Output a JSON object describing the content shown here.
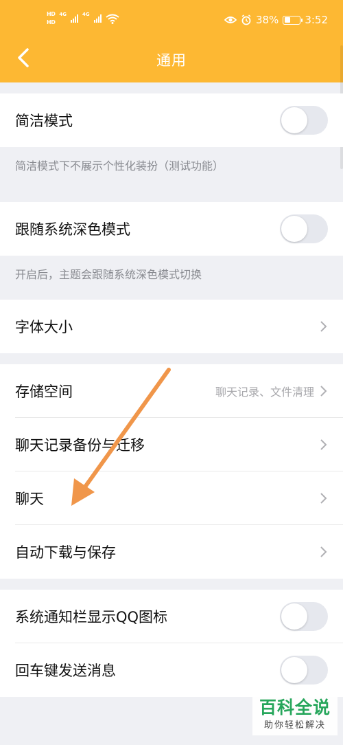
{
  "status_bar": {
    "hd_top": "HD",
    "hd_bottom": "HD",
    "net_1": "4G",
    "net_2": "4G",
    "battery_percent": "38%",
    "battery_level": 0.38,
    "time": "3:52"
  },
  "header": {
    "title": "通用",
    "accent_color": "#fdb833"
  },
  "sections": {
    "simple_mode": {
      "label": "简洁模式",
      "enabled": false,
      "note": "简洁模式下不展示个性化装扮（测试功能）"
    },
    "dark_mode": {
      "label": "跟随系统深色模式",
      "enabled": false,
      "note": "开启后，主题会跟随系统深色模式切换"
    },
    "font_size": {
      "label": "字体大小"
    },
    "storage": {
      "label": "存储空间",
      "value": "聊天记录、文件清理"
    },
    "chat_backup": {
      "label": "聊天记录备份与迁移"
    },
    "chat": {
      "label": "聊天"
    },
    "auto_download": {
      "label": "自动下载与保存"
    },
    "notification_icon": {
      "label": "系统通知栏显示QQ图标",
      "enabled": false
    },
    "enter_send": {
      "label": "回车键发送消息",
      "enabled": false
    }
  },
  "watermark": {
    "title": "百科全说",
    "subtitle": "助你轻松解决"
  }
}
